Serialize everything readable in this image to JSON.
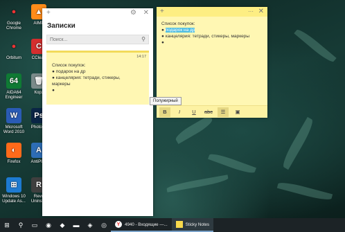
{
  "desktop_icons": [
    {
      "label": "Google Chrome",
      "glyph": "●",
      "color": "#ffffff"
    },
    {
      "label": "AIMP",
      "glyph": "▲",
      "color": "#ff8c1a"
    },
    {
      "label": "Orbitum",
      "glyph": "●",
      "color": "#ffffff"
    },
    {
      "label": "CClean",
      "glyph": "C",
      "color": "#d42e2e"
    },
    {
      "label": "AIDA64 Engineer",
      "glyph": "64",
      "color": "#0f7a34"
    },
    {
      "label": "Корз",
      "glyph": "🗑",
      "color": "#7a8a8a"
    },
    {
      "label": "Microsoft Word 2010",
      "glyph": "W",
      "color": "#2a5bb5"
    },
    {
      "label": "Photosh",
      "glyph": "Ps",
      "color": "#0a2545"
    },
    {
      "label": "Firefox",
      "glyph": "◐",
      "color": "#ff6a1a"
    },
    {
      "label": "AntiPlag",
      "glyph": "A",
      "color": "#2d6db5"
    },
    {
      "label": "Windows 10 Update As...",
      "glyph": "⊞",
      "color": "#1d7ad1"
    },
    {
      "label": "Revo Uninstal",
      "glyph": "R",
      "color": "#3f3f3f"
    }
  ],
  "notes_list": {
    "title": "Записки",
    "search_placeholder": "Поиск...",
    "add_label": "+",
    "settings_label": "⚙",
    "close_label": "✕",
    "card": {
      "time": "14:17",
      "lines": [
        "Список покупок:",
        "● подарок на др",
        "● канцелярия: тетради, стикеры,",
        "маркеры",
        "●"
      ]
    }
  },
  "sticky_note": {
    "add_label": "+",
    "menu_label": "···",
    "close_label": "✕",
    "line1": "Список покупок:",
    "bullet1_prefix": "● ",
    "bullet1_highlight": "подарок на др",
    "line3": "● канцелярия: тетради, стикеры, маркеры",
    "line4": "●",
    "toolbar": [
      {
        "label": "B",
        "name": "bold-button",
        "active": true
      },
      {
        "label": "I",
        "name": "italic-button",
        "active": false
      },
      {
        "label": "U",
        "name": "underline-button",
        "active": false
      },
      {
        "label": "abc",
        "name": "strikethrough-button",
        "active": false
      },
      {
        "label": "☰",
        "name": "bullet-list-button",
        "active": true
      },
      {
        "label": "▣",
        "name": "image-button",
        "active": false
      }
    ]
  },
  "tooltip": "Полужирный",
  "taskbar": {
    "start_glyph": "⊞",
    "search_glyph": "⚲",
    "items": [
      {
        "glyph": "▭",
        "name": "task-view-icon"
      },
      {
        "glyph": "◉",
        "name": "app-icon-1"
      },
      {
        "glyph": "◆",
        "name": "app-icon-2"
      },
      {
        "glyph": "▬",
        "name": "explorer-icon"
      },
      {
        "glyph": "◈",
        "name": "app-icon-3"
      },
      {
        "glyph": "◎",
        "name": "app-icon-4"
      }
    ],
    "yandex_label": "4940 - Входящие —...",
    "yandex_glyph": "Y",
    "sticky_label": "Sticky Notes",
    "sticky_glyph": "▪"
  }
}
